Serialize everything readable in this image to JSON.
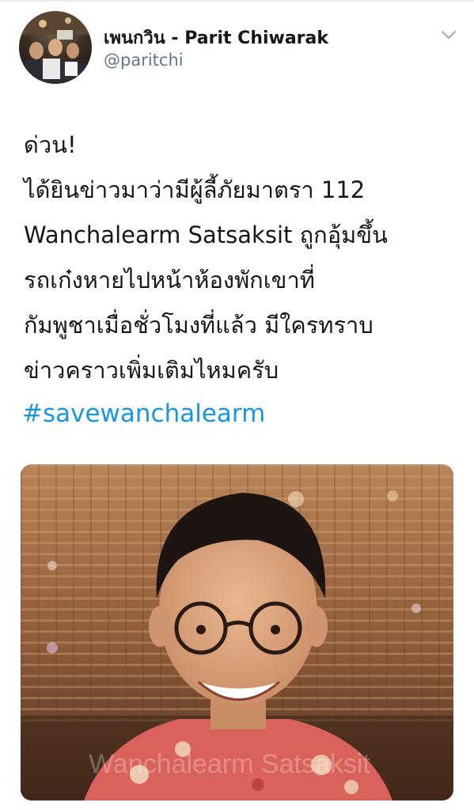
{
  "tweet": {
    "display_name": "เพนกวิน - Parit Chiwarak",
    "handle": "@paritchi",
    "text_lines": [
      "ด่วน!",
      "ได้ยินข่าวมาว่ามีผู้ลี้ภัยมาตรา 112",
      "Wanchalearm Satsaksit ถูกอุ้มขึ้น",
      "รถเก๋งหายไปหน้าห้องพักเขาที่",
      "กัมพูชาเมื่อชั่วโมงที่แล้ว มีใครทราบ",
      "ข่าวคราวเพิ่มเติมไหมครับ"
    ],
    "hashtag": "#savewanchalearm",
    "photo_watermark": "Wanchalearm Satsaksit"
  },
  "icons": {
    "more": "chevron-down-icon",
    "avatar": "profile-avatar"
  },
  "colors": {
    "link": "#1b95e0",
    "handle": "#657786",
    "text": "#14171a"
  }
}
